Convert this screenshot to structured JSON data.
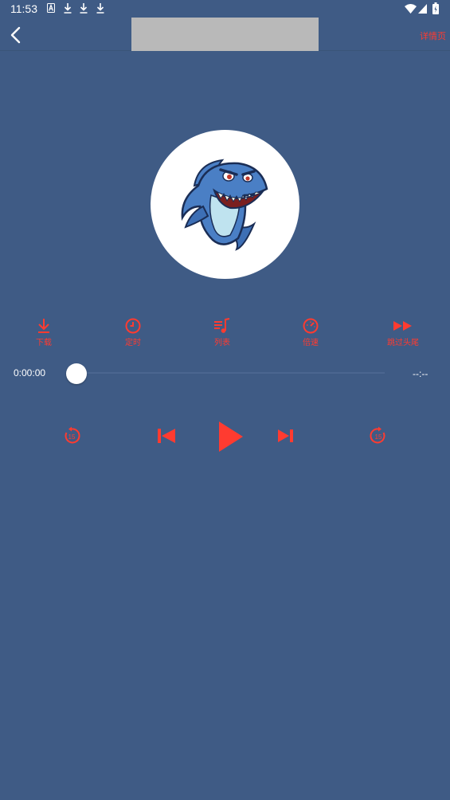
{
  "status_bar": {
    "time": "11:53",
    "icons": [
      "a-notification-icon",
      "download-icon",
      "download-icon",
      "download-icon",
      "wifi-icon",
      "signal-icon",
      "battery-icon"
    ]
  },
  "header": {
    "back_icon": "chevron-left-icon",
    "detail_label": "详情页"
  },
  "functions": [
    {
      "label": "下载",
      "icon": "download-icon"
    },
    {
      "label": "定时",
      "icon": "clock-icon"
    },
    {
      "label": "列表",
      "icon": "playlist-icon"
    },
    {
      "label": "倍速",
      "icon": "speedometer-icon"
    },
    {
      "label": "跳过头尾",
      "icon": "fast-forward-icon"
    }
  ],
  "progress": {
    "current_time": "0:00:00",
    "total_time": "--:--",
    "fraction": 0
  },
  "controls": {
    "rewind_icon": "replay-15-icon",
    "rewind_seconds": "15",
    "previous_icon": "skip-previous-icon",
    "play_icon": "play-icon",
    "next_icon": "skip-next-icon",
    "forward_icon": "forward-15-icon",
    "forward_seconds": "15"
  },
  "colors": {
    "background": "#3f5b85",
    "accent": "#ff3b30",
    "placeholder": "#b9b9b9"
  }
}
